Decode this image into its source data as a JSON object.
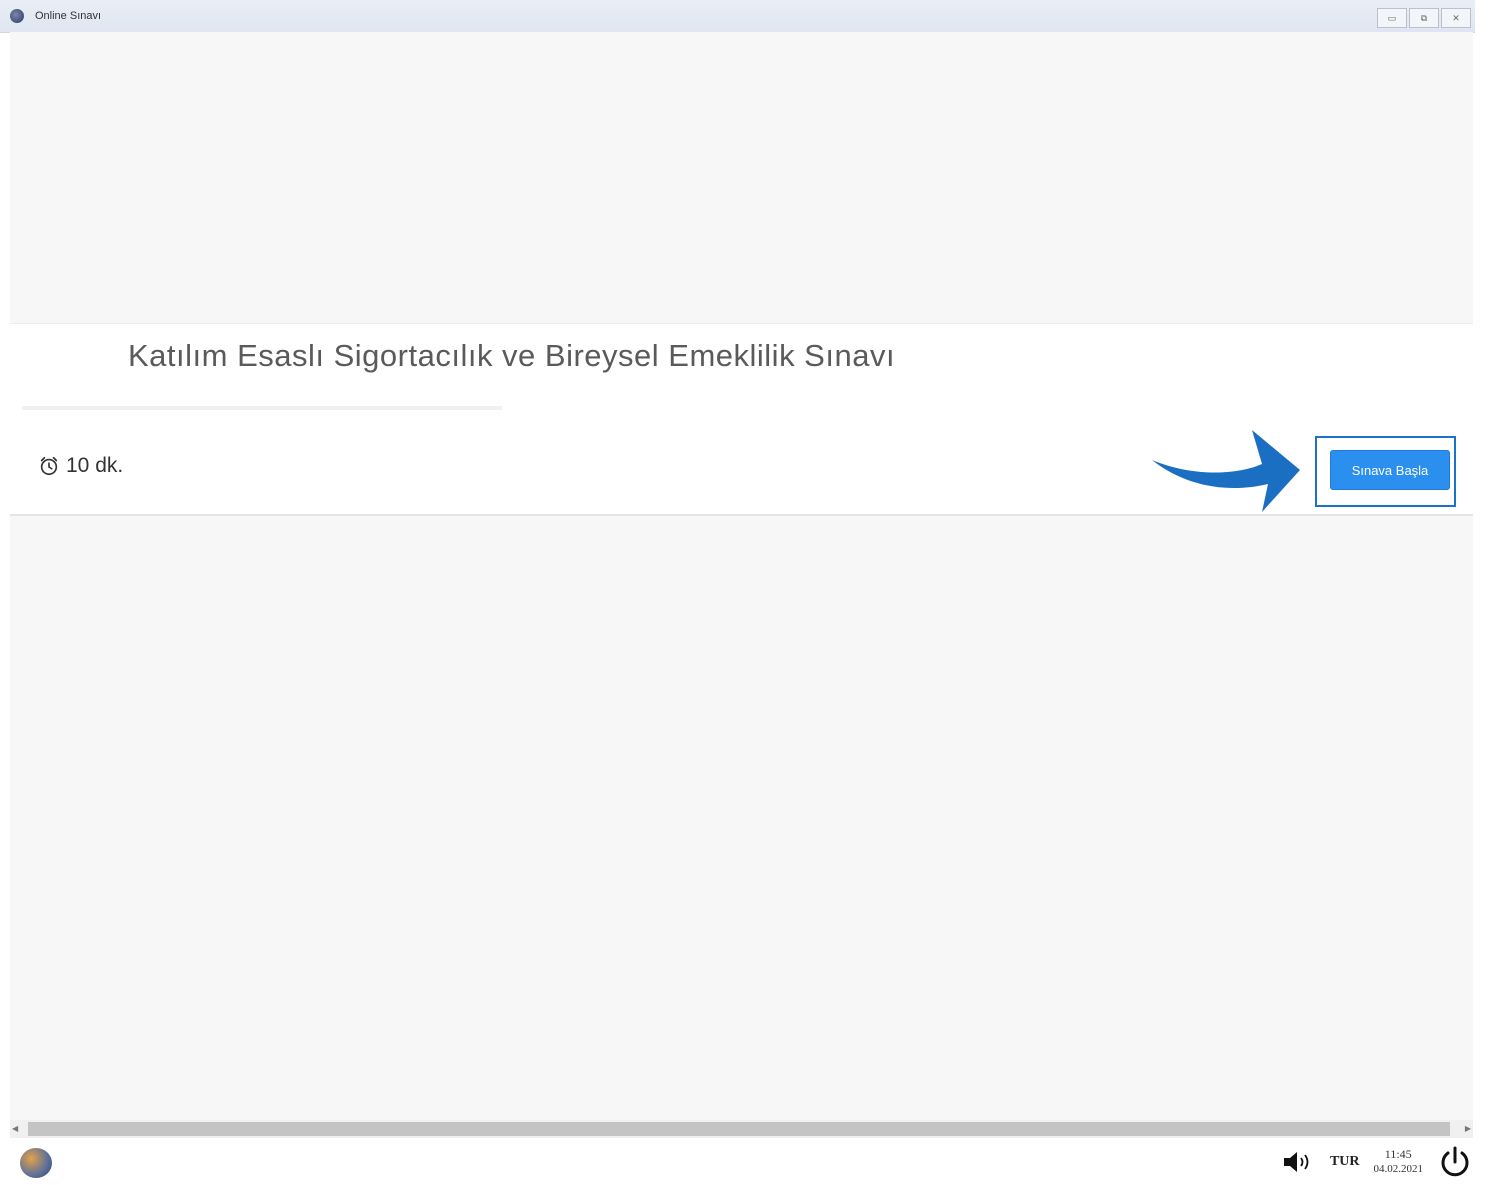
{
  "window": {
    "title": "Online Sınavı",
    "controls": [
      "minimize",
      "restore",
      "close"
    ]
  },
  "exam": {
    "title": "Katılım Esaslı Sigortacılık ve Bireysel Emeklilik Sınavı",
    "duration": "10 dk.",
    "start_button_label": "Sınava Başla"
  },
  "taskbar": {
    "language": "TUR",
    "time": "11:45",
    "date": "04.02.2021"
  },
  "icons": {
    "duration": "alarm-clock-icon",
    "arrow": "arrow-right-icon",
    "speaker": "speaker-icon",
    "power": "power-icon"
  },
  "colors": {
    "button": "#2b8ff0",
    "highlight": "#1a73c9"
  }
}
